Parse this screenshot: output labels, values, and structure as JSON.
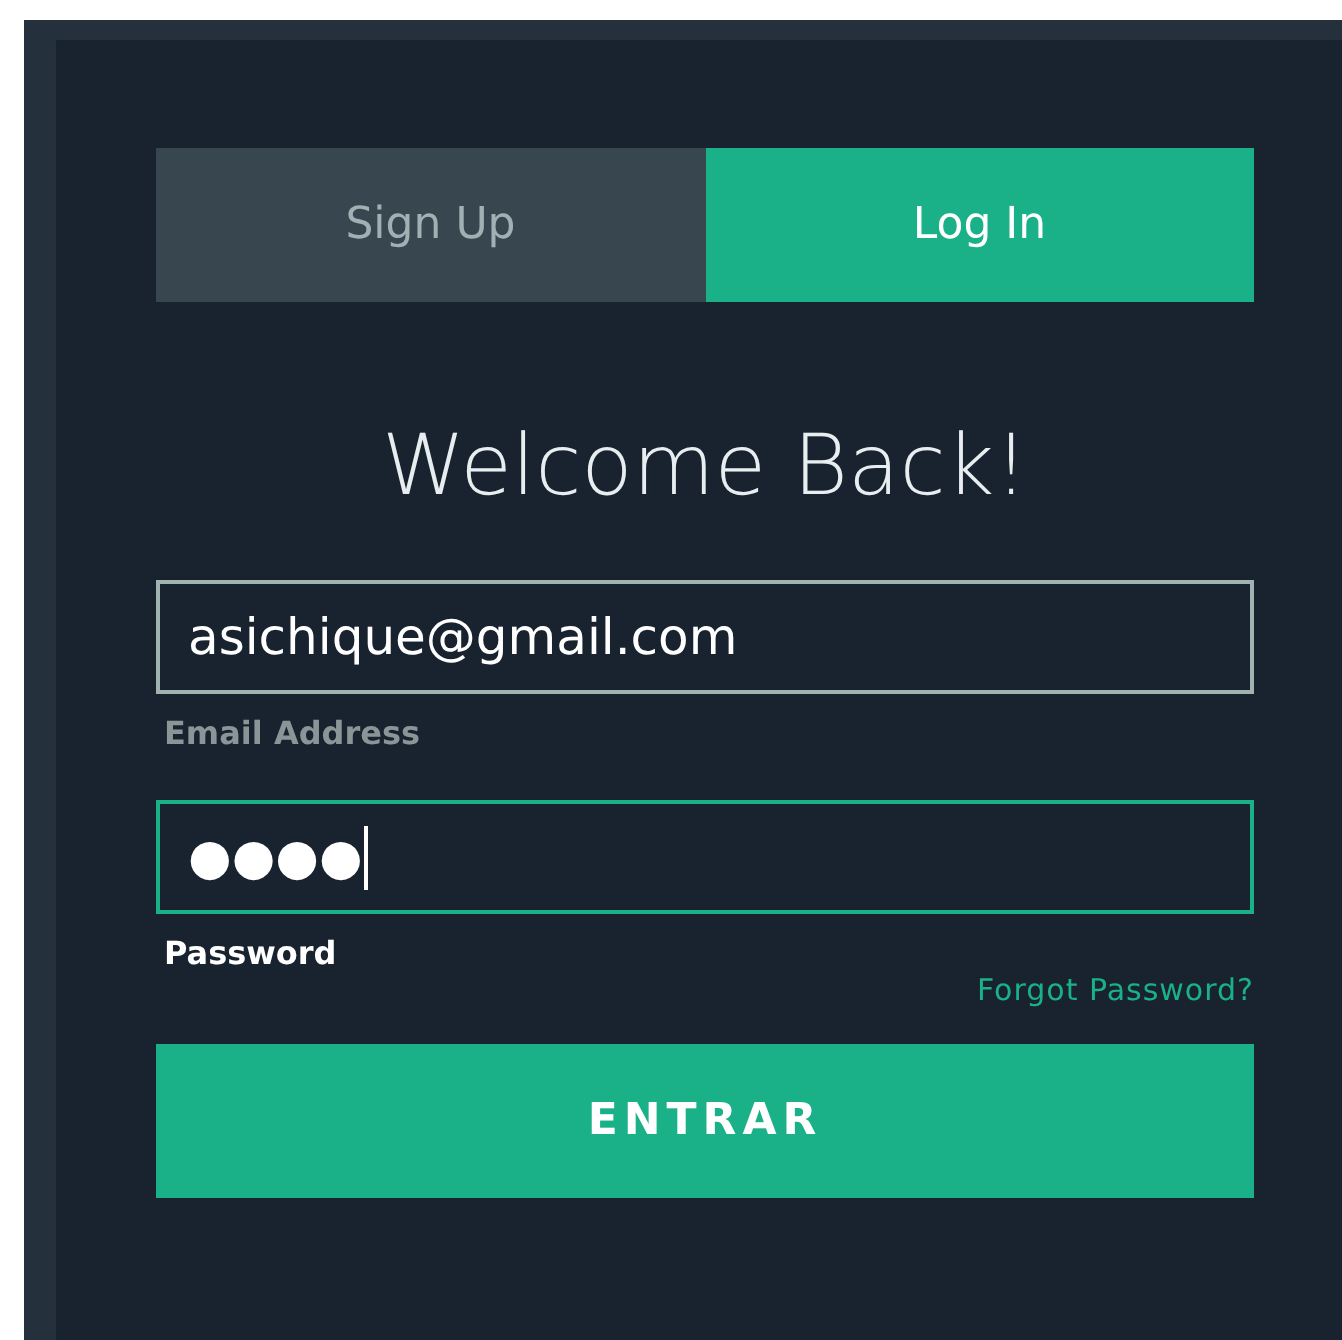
{
  "tabs": [
    {
      "label": "Sign Up",
      "selected": false
    },
    {
      "label": "Log In",
      "selected": true
    }
  ],
  "heading": "Welcome Back!",
  "fields": [
    {
      "value": "asichique@gmail.com",
      "label": "Email Address",
      "focused": false
    },
    {
      "value": "●●●●",
      "label": "Password",
      "focused": true
    }
  ],
  "forgot_link": "Forgot Password?",
  "submit_button": "ENTRAR"
}
